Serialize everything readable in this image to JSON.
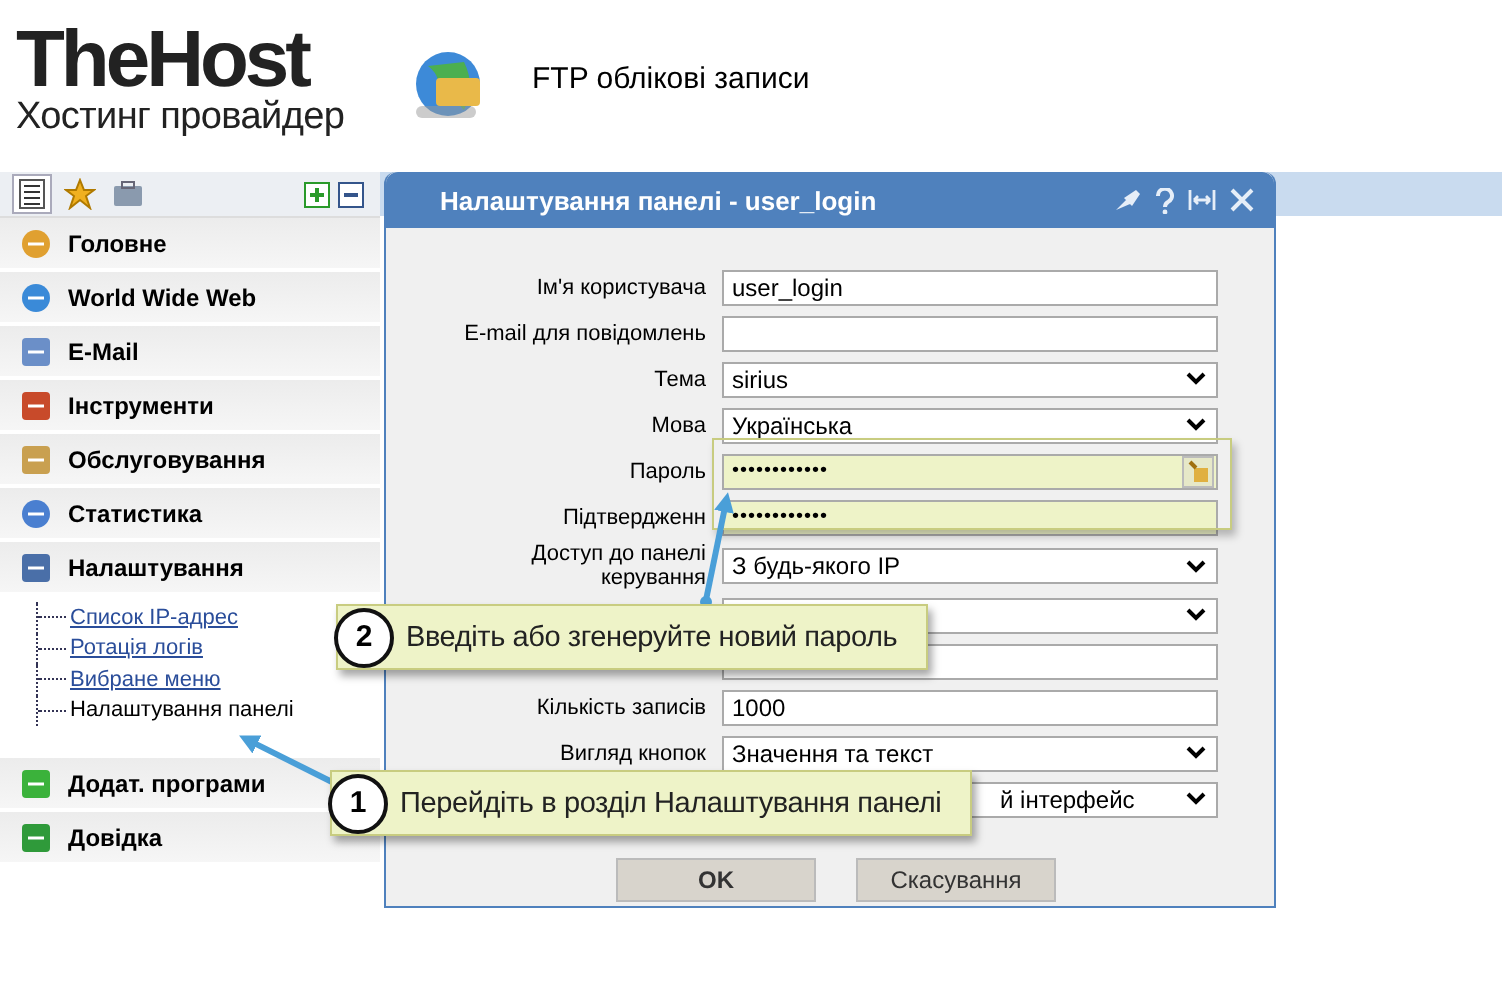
{
  "logo": {
    "name": "TheHost",
    "tagline": "Хостинг провайдер"
  },
  "page_title": "FTP облікові записи",
  "sidebar": {
    "tabs": [
      {
        "selected": true
      },
      {
        "selected": false
      },
      {
        "selected": false
      }
    ],
    "items": [
      {
        "label": "Головне"
      },
      {
        "label": "World Wide Web"
      },
      {
        "label": "E-Mail"
      },
      {
        "label": "Інструменти"
      },
      {
        "label": "Обслуговування"
      },
      {
        "label": "Статистика"
      },
      {
        "label": "Налаштування",
        "children": [
          {
            "label": "Список IP-адрес",
            "selected": false
          },
          {
            "label": "Ротація логів",
            "selected": false
          },
          {
            "label": "Вибране меню",
            "selected": false
          },
          {
            "label": "Налаштування панелі",
            "selected": true
          }
        ]
      },
      {
        "label": "Додат. програми"
      },
      {
        "label": "Довідка"
      }
    ]
  },
  "dialog": {
    "title": "Налаштування панелі - user_login",
    "fields": [
      {
        "kind": "text",
        "label": "Ім'я користувача",
        "value": "user_login"
      },
      {
        "kind": "text",
        "label": "E-mail для повідомлень"
      },
      {
        "kind": "select",
        "label": "Тема",
        "value": "sirius"
      },
      {
        "kind": "select",
        "label": "Мова",
        "value": "Українська"
      },
      {
        "kind": "password",
        "label": "Пароль",
        "value": "••••••••••••"
      },
      {
        "kind": "password",
        "label": "Підтвердженн",
        "value": "••••••••••••"
      },
      {
        "kind": "select",
        "label": "Доступ до панелі керування",
        "value": "З будь-якого IP"
      },
      {
        "kind": "select"
      },
      {
        "kind": "text"
      },
      {
        "kind": "text",
        "label": "Кількість записів",
        "value": "1000"
      },
      {
        "kind": "select",
        "label": "Вигляд кнопок",
        "value": "Значення та текст"
      },
      {
        "kind": "select",
        "value": "й інтерфейс"
      }
    ],
    "buttons": [
      "OK",
      "Скасування"
    ]
  },
  "callouts": [
    {
      "number": "2",
      "text": "Введіть або згенеруйте новий пароль"
    },
    {
      "number": "1",
      "text": "Перейдіть в розділ Налаштування панелі"
    }
  ]
}
